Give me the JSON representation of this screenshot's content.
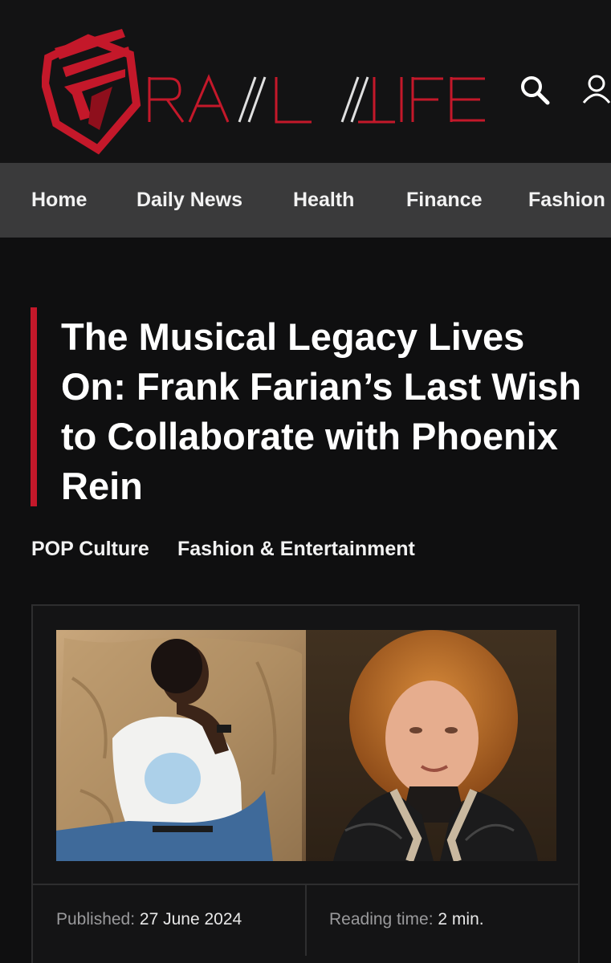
{
  "brand": {
    "name": "RAIL LIFE",
    "accent_color": "#c4182a"
  },
  "header": {
    "search_icon": "search-icon",
    "user_icon": "user-icon"
  },
  "nav": {
    "items": [
      {
        "label": "Home"
      },
      {
        "label": "Daily News"
      },
      {
        "label": "Health"
      },
      {
        "label": "Finance"
      },
      {
        "label": "Fashion"
      }
    ]
  },
  "article": {
    "title": "The Musical Legacy Lives On: Frank Farian’s Last Wish to Collaborate with Phoenix Rein",
    "categories": [
      {
        "label": "POP Culture"
      },
      {
        "label": "Fashion & Entertainment"
      }
    ],
    "meta": {
      "published_label": "Published:",
      "published_value": "27 June 2024",
      "reading_label": "Reading time:",
      "reading_value": "2 min."
    }
  }
}
